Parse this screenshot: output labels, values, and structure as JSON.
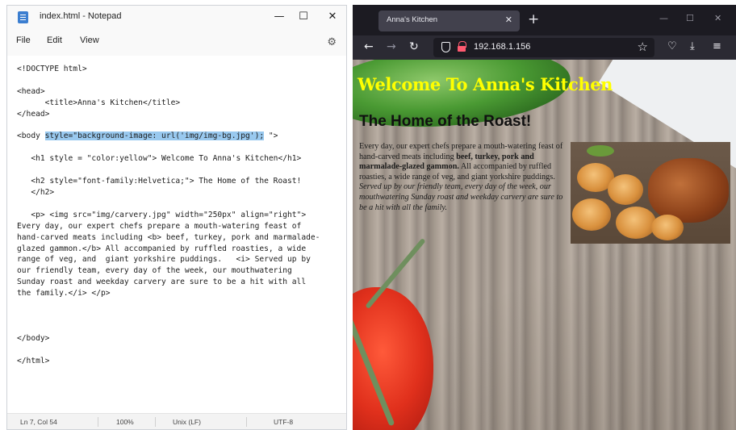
{
  "notepad": {
    "title": "index.html - Notepad",
    "controls": {
      "minimize": "—",
      "maximize": "☐",
      "close": "✕"
    },
    "menu": [
      "File",
      "Edit",
      "View"
    ],
    "code": {
      "l1": "<!DOCTYPE html>",
      "l2": "<head>",
      "l3": "      <title>Anna's Kitchen</title>",
      "l4": "</head>",
      "l5_pre": "<body ",
      "l5_sel": "style=\"background-image: url('img/img-bg.jpg');",
      "l5_post": " \">",
      "l6": "   <h1 style = \"color:yellow\"> Welcome To Anna's Kitchen</h1>",
      "l7": "   <h2 style=\"font-family:Helvetica;\"> The Home of the Roast!\n   </h2>",
      "l8": "   <p> <img src=\"img/carvery.jpg\" width=\"250px\" align=\"right\">\nEvery day, our expert chefs prepare a mouth-watering feast of\nhand-carved meats including <b> beef, turkey, pork and marmalade-\nglazed gammon.</b> All accompanied by ruffled roasties, a wide\nrange of veg, and  giant yorkshire puddings.   <i> Served up by\nour friendly team, every day of the week, our mouthwatering\nSunday roast and weekday carvery are sure to be a hit with all\nthe family.</i> </p>",
      "l9": "</body>",
      "l10": "</html>"
    },
    "status": {
      "position": "Ln 7, Col 54",
      "zoom": "100%",
      "line_ending": "Unix (LF)",
      "encoding": "UTF-8"
    }
  },
  "browser": {
    "tab_title": "Anna's Kitchen",
    "tab_close": "✕",
    "new_tab": "+",
    "window_controls": {
      "minimize": "—",
      "maximize": "☐",
      "close": "✕"
    },
    "nav": {
      "back": "←",
      "forward": "→",
      "reload": "↻"
    },
    "url": "192.168.1.156",
    "toolbar": {
      "bookmark": "☆",
      "pocket": "♡",
      "downloads": "⤓",
      "menu": "≡"
    },
    "page": {
      "h1": "Welcome To Anna's Kitchen",
      "h2": "The Home of the Roast!",
      "p_start": "Every day, our expert chefs prepare a mouth-watering feast of hand-carved meats including ",
      "p_bold": "beef, turkey, pork and marmalade-glazed gammon.",
      "p_mid": " All accompanied by ruffled roasties, a wide range of veg, and giant yorkshire puddings. ",
      "p_italic": "Served up by our friendly team, every day of the week, our mouthwatering Sunday roast and weekday carvery are sure to be a hit with all the family."
    },
    "colors": {
      "h1": "#ffff00",
      "chrome": "#1c1b22",
      "toolbar": "#2b2a33",
      "lock": "#ff5a70"
    }
  },
  "icons": [
    "notepad-icon",
    "gear-icon",
    "shield-icon",
    "lock-icon",
    "star-icon",
    "pocket-icon",
    "download-icon",
    "menu-icon"
  ]
}
